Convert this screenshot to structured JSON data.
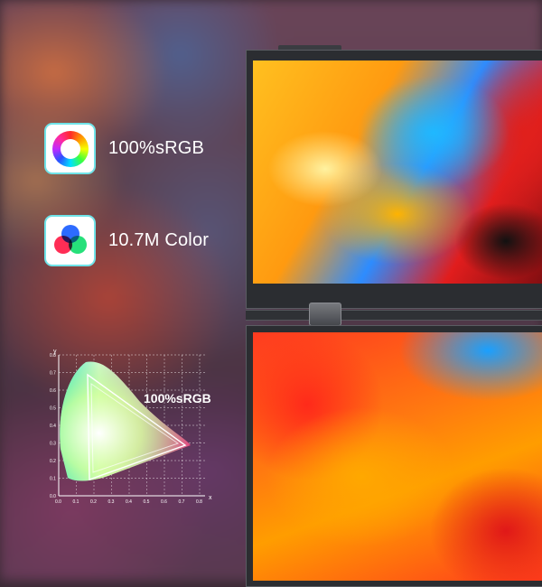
{
  "features": [
    {
      "icon": "color-wheel-icon",
      "label": "100%sRGB"
    },
    {
      "icon": "rgb-circles-icon",
      "label": "10.7M Color"
    }
  ],
  "gamut": {
    "label": "100%sRGB",
    "y_axis_label": "y",
    "x_axis_label": "x",
    "y_ticks": [
      "0.8",
      "0.7",
      "0.6",
      "0.5",
      "0.4",
      "0.3",
      "0.2",
      "0.1",
      "0.0"
    ],
    "x_ticks": [
      "0.0",
      "0.1",
      "0.2",
      "0.3",
      "0.4",
      "0.5",
      "0.6",
      "0.7",
      "0.8"
    ]
  },
  "colors": {
    "tile_border": "#6fe3e8",
    "label_text": "#ffffff",
    "bezel": "#2b2d31"
  }
}
